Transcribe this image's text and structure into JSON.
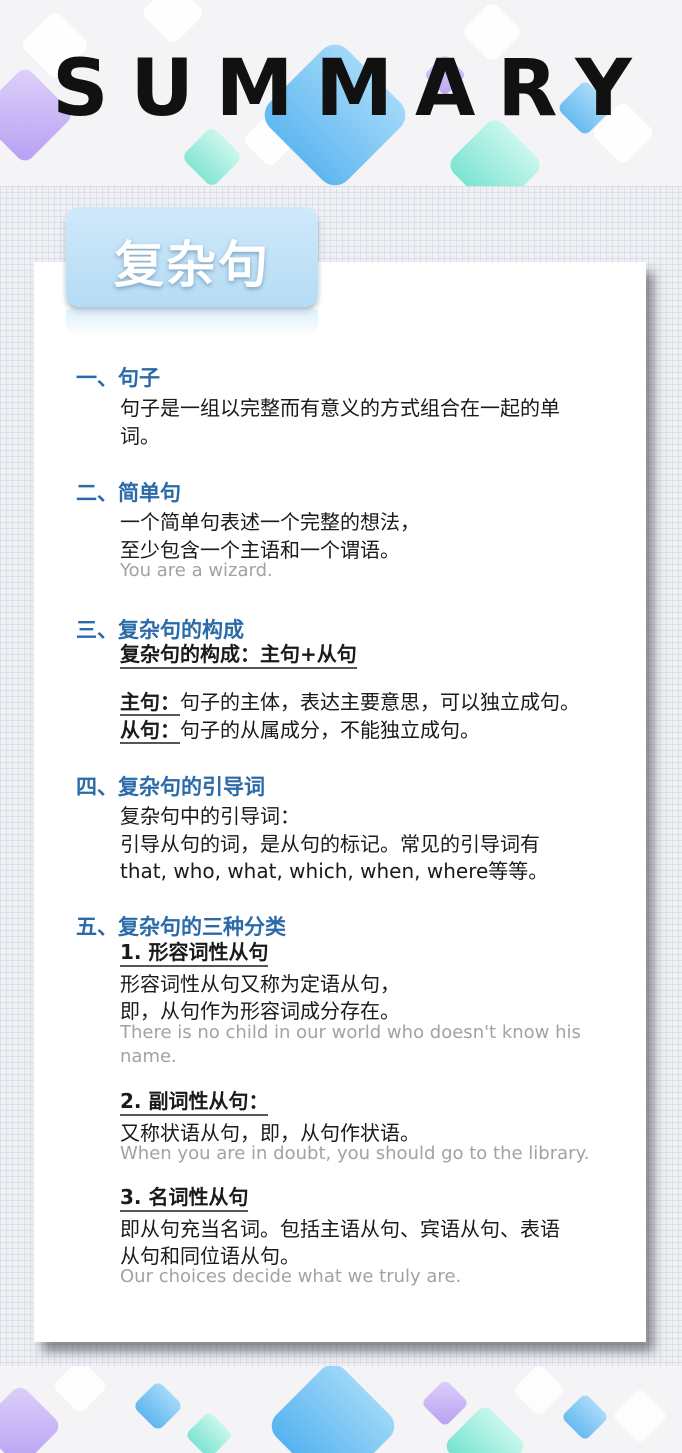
{
  "header": {
    "title": "SUMMARY"
  },
  "card": {
    "tab_title": "复杂句",
    "sections": [
      {
        "title": "一、句子",
        "lines": [
          "句子是一组以完整而有意义的方式组合在一起的单",
          "词。"
        ]
      },
      {
        "title": "二、简单句",
        "lines": [
          "一个简单句表述一个完整的想法，",
          "至少包含一个主语和一个谓语。"
        ],
        "example": "You are a wizard."
      },
      {
        "title": "三、复杂句的构成",
        "subhead": "复杂句的构成：主句+从句",
        "items": [
          {
            "label": "主句：",
            "text": "句子的主体，表达主要意思，可以独立成句。"
          },
          {
            "label": "从句：",
            "text": "句子的从属成分，不能独立成句。"
          }
        ]
      },
      {
        "title": "四、复杂句的引导词",
        "lines": [
          "复杂句中的引导词：",
          "引导从句的词，是从句的标记。常见的引导词有",
          "that, who, what, which, when, where等等。"
        ]
      },
      {
        "title": "五、复杂句的三种分类",
        "types": [
          {
            "head": "1. 形容词性从句",
            "lines": [
              "形容词性从句又称为定语从句，",
              "即，从句作为形容词成分存在。"
            ],
            "example": [
              "There is no child in our world who doesn't know his",
              "name."
            ]
          },
          {
            "head": "2. 副词性从句：",
            "lines": [
              "又称状语从句，即，从句作状语。"
            ],
            "example": [
              "When you are in doubt, you should go to the library."
            ]
          },
          {
            "head": "3. 名词性从句",
            "lines": [
              "即从句充当名词。包括主语从句、宾语从句、表语",
              "从句和同位语从句。"
            ],
            "example": [
              "Our choices decide what we truly are."
            ]
          }
        ]
      }
    ]
  },
  "colors": {
    "section_title": "#2a6aa8",
    "body_text": "#1a1a1a",
    "example_text": "#a2a2a2",
    "tab": "#c4e4f8",
    "accent_blue": "#4fb6f0",
    "accent_mint": "#6fe6d0",
    "accent_purple": "#b69cf0"
  }
}
